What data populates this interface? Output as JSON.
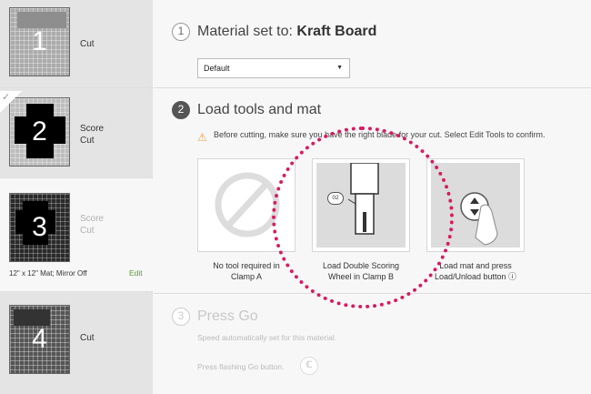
{
  "sidebar": {
    "mats": [
      {
        "number": "1",
        "lines": [
          "Cut"
        ]
      },
      {
        "number": "2",
        "lines": [
          "Score",
          "Cut"
        ]
      },
      {
        "number": "3",
        "lines": [
          "Score",
          "Cut"
        ],
        "info": "12\" x 12\" Mat; Mirror Off",
        "edit_label": "Edit"
      },
      {
        "number": "4",
        "lines": [
          "Cut"
        ]
      }
    ]
  },
  "steps": {
    "step1": {
      "number": "1",
      "title_prefix": "Material set to:",
      "material": "Kraft Board",
      "select_value": "Default"
    },
    "step2": {
      "number": "2",
      "title": "Load tools and mat",
      "warning": "Before cutting, make sure you have the right blade for your cut. Select Edit Tools to confirm.",
      "cards": [
        {
          "caption_line1": "No tool required in",
          "caption_line2": "Clamp A"
        },
        {
          "caption_line1": "Load Double Scoring",
          "caption_line2": "Wheel in Clamp B",
          "badge": "02"
        },
        {
          "caption_line1": "Load mat and press",
          "caption_line2": "Load/Unload button ⓘ"
        }
      ]
    },
    "step3": {
      "number": "3",
      "title": "Press Go",
      "speed_note": "Speed automatically set for this material.",
      "go_note": "Press flashing Go button.",
      "go_glyph": "ℂ"
    }
  },
  "colors": {
    "accent": "#5b9b32",
    "highlight_ring": "#d81b60",
    "warning": "#e8a24a"
  }
}
